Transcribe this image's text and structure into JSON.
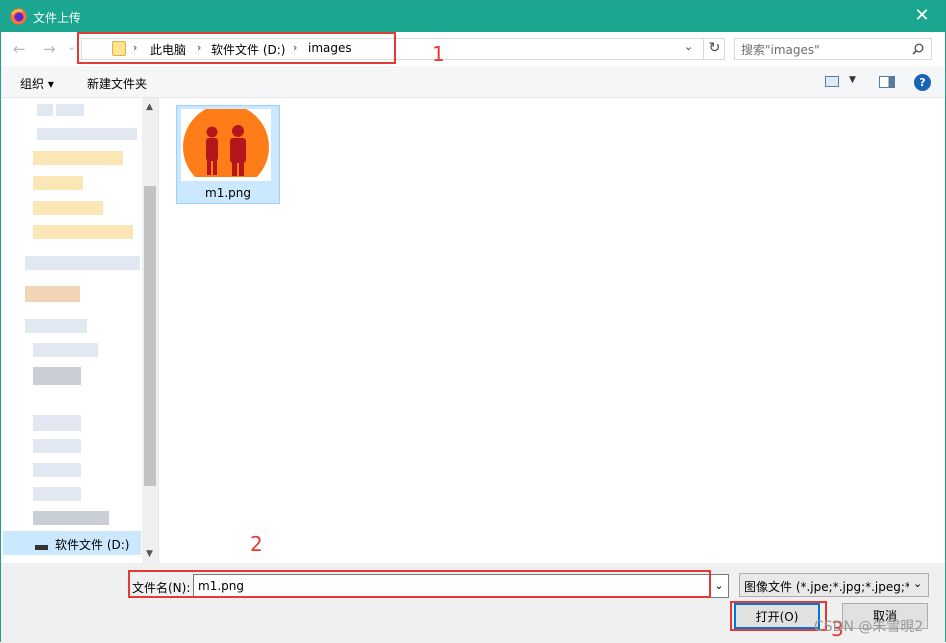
{
  "window": {
    "title": "文件上传",
    "close_glyph": "✕"
  },
  "nav": {
    "back": "←",
    "forward": "→",
    "recent": "⌄",
    "up": "↑"
  },
  "address": {
    "separator": "›",
    "crumbs": [
      "此电脑",
      "软件文件 (D:)",
      "images"
    ],
    "refresh": "↻",
    "dropdown": "⌄"
  },
  "search": {
    "placeholder": "搜索\"images\""
  },
  "toolbar": {
    "organize": "组织 ▾",
    "new_folder": "新建文件夹",
    "help": "?"
  },
  "sidebar": {
    "selected_drive": "软件文件 (D:)"
  },
  "files": [
    {
      "name": "m1.png"
    }
  ],
  "bottom": {
    "filename_label": "文件名(N):",
    "filename_value": "m1.png",
    "filter_value": "图像文件 (*.jpe;*.jpg;*.jpeg;*.g",
    "open": "打开(O)",
    "cancel": "取消"
  },
  "annotations": {
    "one": "1",
    "two": "2",
    "three": "3"
  },
  "watermark": "CSDN @朱雪晛2"
}
